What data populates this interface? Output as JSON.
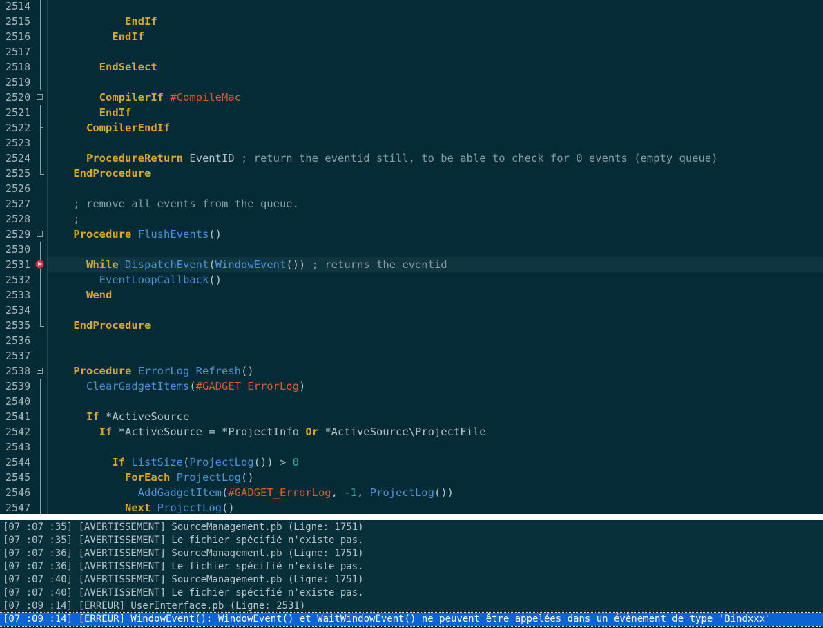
{
  "editor": {
    "current_line": "2531",
    "breakpoint_line": "2531",
    "lines": [
      {
        "num": "2514",
        "indent": "",
        "fold": "line",
        "tokens": []
      },
      {
        "num": "2515",
        "indent": "          ",
        "fold": "line",
        "tokens": [
          {
            "t": "EndIf",
            "c": "kw"
          }
        ]
      },
      {
        "num": "2516",
        "indent": "        ",
        "fold": "line",
        "tokens": [
          {
            "t": "EndIf",
            "c": "kw"
          }
        ]
      },
      {
        "num": "2517",
        "indent": "",
        "fold": "line",
        "tokens": []
      },
      {
        "num": "2518",
        "indent": "      ",
        "fold": "line",
        "tokens": [
          {
            "t": "EndSelect",
            "c": "kw"
          }
        ]
      },
      {
        "num": "2519",
        "indent": "",
        "fold": "line",
        "tokens": []
      },
      {
        "num": "2520",
        "indent": "      ",
        "fold": "box",
        "tokens": [
          {
            "t": "CompilerIf",
            "c": "kw"
          },
          {
            "t": " ",
            "c": "tx"
          },
          {
            "t": "#CompileMac",
            "c": "const"
          }
        ]
      },
      {
        "num": "2521",
        "indent": "      ",
        "fold": "line",
        "tokens": [
          {
            "t": "EndIf",
            "c": "kw"
          }
        ]
      },
      {
        "num": "2522",
        "indent": "    ",
        "fold": "tick",
        "tokens": [
          {
            "t": "CompilerEndIf",
            "c": "kw"
          }
        ]
      },
      {
        "num": "2523",
        "indent": "",
        "fold": "line",
        "tokens": []
      },
      {
        "num": "2524",
        "indent": "    ",
        "fold": "line",
        "tokens": [
          {
            "t": "ProcedureReturn",
            "c": "kw"
          },
          {
            "t": " EventID ",
            "c": "tx"
          },
          {
            "t": "; return the eventid still, to be able to check for 0 events (empty queue)",
            "c": "cm"
          }
        ]
      },
      {
        "num": "2525",
        "indent": "  ",
        "fold": "end",
        "tokens": [
          {
            "t": "EndProcedure",
            "c": "kw"
          }
        ]
      },
      {
        "num": "2526",
        "indent": "",
        "fold": "none",
        "tokens": []
      },
      {
        "num": "2527",
        "indent": "  ",
        "fold": "none",
        "tokens": [
          {
            "t": "; remove all events from the queue.",
            "c": "cm"
          }
        ]
      },
      {
        "num": "2528",
        "indent": "  ",
        "fold": "none",
        "tokens": [
          {
            "t": ";",
            "c": "cm"
          }
        ]
      },
      {
        "num": "2529",
        "indent": "  ",
        "fold": "box",
        "tokens": [
          {
            "t": "Procedure",
            "c": "kw"
          },
          {
            "t": " ",
            "c": "tx"
          },
          {
            "t": "FlushEvents",
            "c": "fn"
          },
          {
            "t": "()",
            "c": "tx"
          }
        ]
      },
      {
        "num": "2530",
        "indent": "",
        "fold": "line",
        "tokens": []
      },
      {
        "num": "2531",
        "indent": "    ",
        "fold": "bp",
        "tokens": [
          {
            "t": "While",
            "c": "kw"
          },
          {
            "t": " ",
            "c": "tx"
          },
          {
            "t": "DispatchEvent",
            "c": "fn"
          },
          {
            "t": "(",
            "c": "tx"
          },
          {
            "t": "WindowEvent",
            "c": "fn"
          },
          {
            "t": "()) ",
            "c": "tx"
          },
          {
            "t": "; returns the eventid",
            "c": "cm"
          }
        ]
      },
      {
        "num": "2532",
        "indent": "      ",
        "fold": "line",
        "tokens": [
          {
            "t": "EventLoopCallback",
            "c": "fn"
          },
          {
            "t": "()",
            "c": "tx"
          }
        ]
      },
      {
        "num": "2533",
        "indent": "    ",
        "fold": "line",
        "tokens": [
          {
            "t": "Wend",
            "c": "kw"
          }
        ]
      },
      {
        "num": "2534",
        "indent": "",
        "fold": "line",
        "tokens": []
      },
      {
        "num": "2535",
        "indent": "  ",
        "fold": "end",
        "tokens": [
          {
            "t": "EndProcedure",
            "c": "kw"
          }
        ]
      },
      {
        "num": "2536",
        "indent": "",
        "fold": "none",
        "tokens": []
      },
      {
        "num": "2537",
        "indent": "",
        "fold": "none",
        "tokens": []
      },
      {
        "num": "2538",
        "indent": "  ",
        "fold": "box",
        "tokens": [
          {
            "t": "Procedure",
            "c": "kw"
          },
          {
            "t": " ",
            "c": "tx"
          },
          {
            "t": "ErrorLog_Refresh",
            "c": "fn"
          },
          {
            "t": "()",
            "c": "tx"
          }
        ]
      },
      {
        "num": "2539",
        "indent": "    ",
        "fold": "line",
        "tokens": [
          {
            "t": "ClearGadgetItems",
            "c": "fn"
          },
          {
            "t": "(",
            "c": "tx"
          },
          {
            "t": "#GADGET_ErrorLog",
            "c": "const"
          },
          {
            "t": ")",
            "c": "tx"
          }
        ]
      },
      {
        "num": "2540",
        "indent": "",
        "fold": "line",
        "tokens": []
      },
      {
        "num": "2541",
        "indent": "    ",
        "fold": "line",
        "tokens": [
          {
            "t": "If",
            "c": "kw"
          },
          {
            "t": " *ActiveSource",
            "c": "tx"
          }
        ]
      },
      {
        "num": "2542",
        "indent": "      ",
        "fold": "line",
        "tokens": [
          {
            "t": "If",
            "c": "kw"
          },
          {
            "t": " *ActiveSource = *ProjectInfo ",
            "c": "tx"
          },
          {
            "t": "Or",
            "c": "kw"
          },
          {
            "t": " *ActiveSource\\ProjectFile",
            "c": "tx"
          }
        ]
      },
      {
        "num": "2543",
        "indent": "",
        "fold": "line",
        "tokens": []
      },
      {
        "num": "2544",
        "indent": "        ",
        "fold": "line",
        "tokens": [
          {
            "t": "If",
            "c": "kw"
          },
          {
            "t": " ",
            "c": "tx"
          },
          {
            "t": "ListSize",
            "c": "fn"
          },
          {
            "t": "(",
            "c": "tx"
          },
          {
            "t": "ProjectLog",
            "c": "fn"
          },
          {
            "t": "()) > ",
            "c": "tx"
          },
          {
            "t": "0",
            "c": "num"
          }
        ]
      },
      {
        "num": "2545",
        "indent": "          ",
        "fold": "line",
        "tokens": [
          {
            "t": "ForEach",
            "c": "kw"
          },
          {
            "t": " ",
            "c": "tx"
          },
          {
            "t": "ProjectLog",
            "c": "fn"
          },
          {
            "t": "()",
            "c": "tx"
          }
        ]
      },
      {
        "num": "2546",
        "indent": "            ",
        "fold": "line",
        "tokens": [
          {
            "t": "AddGadgetItem",
            "c": "fn"
          },
          {
            "t": "(",
            "c": "tx"
          },
          {
            "t": "#GADGET_ErrorLog",
            "c": "const"
          },
          {
            "t": ", ",
            "c": "tx"
          },
          {
            "t": "-1",
            "c": "num"
          },
          {
            "t": ", ",
            "c": "tx"
          },
          {
            "t": "ProjectLog",
            "c": "fn"
          },
          {
            "t": "())",
            "c": "tx"
          }
        ]
      },
      {
        "num": "2547",
        "indent": "          ",
        "fold": "line",
        "tokens": [
          {
            "t": "Next",
            "c": "kw"
          },
          {
            "t": " ",
            "c": "tx"
          },
          {
            "t": "ProjectLog",
            "c": "fn"
          },
          {
            "t": "()",
            "c": "tx"
          }
        ]
      }
    ]
  },
  "log": {
    "selected_index": 7,
    "entries": [
      "[07 :07 :35] [AVERTISSEMENT] SourceManagement.pb (Ligne: 1751)",
      "[07 :07 :35] [AVERTISSEMENT] Le fichier spécifié n'existe pas.",
      "[07 :07 :36] [AVERTISSEMENT] SourceManagement.pb (Ligne: 1751)",
      "[07 :07 :36] [AVERTISSEMENT] Le fichier spécifié n'existe pas.",
      "[07 :07 :40] [AVERTISSEMENT] SourceManagement.pb (Ligne: 1751)",
      "[07 :07 :40] [AVERTISSEMENT] Le fichier spécifié n'existe pas.",
      "[07 :09 :14] [ERREUR] UserInterface.pb (Ligne: 2531)",
      "[07 :09 :14] [ERREUR] WindowEvent(): WindowEvent() et WaitWindowEvent() ne peuvent être appelées dans un évènement de type 'Bindxxx'"
    ]
  },
  "colors": {
    "editor_bg": "#052b36",
    "keyword": "#d8a62f",
    "function": "#4b93d7",
    "constant": "#dd5a2c",
    "number": "#1fb1a6",
    "comment": "#8a9ea5",
    "selection": "#0a64d6"
  }
}
